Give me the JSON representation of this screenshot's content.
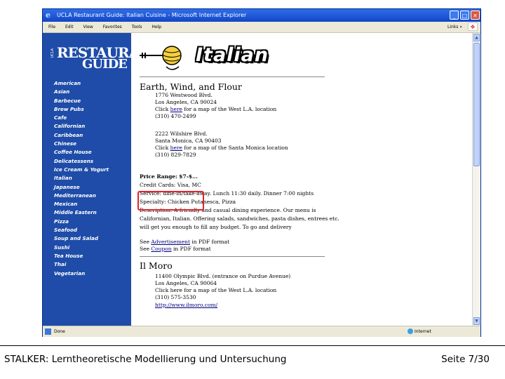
{
  "window": {
    "title": "UCLA Restaurant Guide: Italian Cuisine - Microsoft Internet Explorer",
    "menu": [
      "File",
      "Edit",
      "View",
      "Favorites",
      "Tools",
      "Help"
    ],
    "links_label": "Links",
    "links_arrow": "»",
    "status": "Done",
    "zone": "Internet"
  },
  "sidebar": {
    "logo_small": "UCLA",
    "logo_restaurant": "RESTAURANT",
    "logo_guide": "GUIDE",
    "items": [
      "American",
      "Asian",
      "Barbecue",
      "Brew Pubs",
      "Cafe",
      "Californian",
      "Caribbean",
      "Chinese",
      "Coffee House",
      "Delicatessens",
      "Ice Cream & Yogurt",
      "Italian",
      "Japanese",
      "Mediterranean",
      "Mexican",
      "Middle Eastern",
      "Pizza",
      "Seafood",
      "Soup and Salad",
      "Sushi",
      "Tea House",
      "Thai",
      "Vegetarian"
    ]
  },
  "content": {
    "heading": "Italian",
    "restaurant1": {
      "name": "Earth, Wind, and Flour",
      "addr1": [
        "1776 Westwood Blvd.",
        "Los Angeles, CA 90024"
      ],
      "map1_pre": "Click ",
      "map1_link": "here",
      "map1_post": " for a map of the West L.A. location",
      "phone1": "(310) 470-2499",
      "addr2": [
        "2222 Wilshire Blvd.",
        "Santa Monica, CA 90403"
      ],
      "map2_pre": "Click ",
      "map2_link": "here",
      "map2_post": " for a map of the Santa Monica location",
      "phone2": "(310) 829-7829",
      "price_label": "Price Range:",
      "price_value": "$7-$...",
      "credit": "Credit Cards: Visa, MC",
      "service": "Service: dine-in/take-away. Lunch 11:30 daily. Dinner 7:00 nights",
      "specialty": "Specialty: Chicken Putanesca, Pizza",
      "desc1": "Description: A friendly and casual dining experience. Our menu is",
      "desc2": "Californian, Italian. Offering salads, sandwiches, pasta dishes, entrees etc.",
      "desc3": "will get you enough to fill any budget. To go and delivery",
      "see1_pre": "See ",
      "see1_link": "Advertisement",
      "see1_post": " in PDF format",
      "see2_pre": "See ",
      "see2_link": "Coupon",
      "see2_post": " in PDF format"
    },
    "restaurant2": {
      "name": "Il Moro",
      "addr1": "11400 Olympic Blvd. (entrance on Purdue Avenue)",
      "addr2": "Los Angeles, CA 90064",
      "map": "Click here for a map of the West L.A. location",
      "phone": "(310) 575-3530",
      "url": "http://www.ilmoro.com/"
    }
  },
  "slide": {
    "footer_left": "STALKER: Lerntheoretische Modellierung und Untersuchung",
    "footer_right": "Seite 7/30"
  },
  "colors": {
    "sidebar_bg": "#1e4ca8",
    "highlight_box": "#e0242c",
    "titlebar": "#1246c6"
  }
}
